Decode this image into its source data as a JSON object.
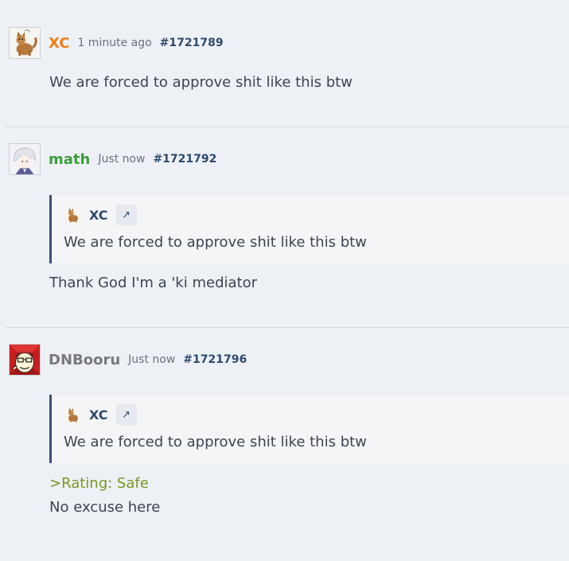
{
  "colors": {
    "background": "#edf1f6",
    "user_xc": "#ef7d1a",
    "user_math": "#3a9e3a",
    "user_dnbooru": "#7a7a7a",
    "post_id": "#2d4a6e",
    "greentext": "#789922",
    "quote_border": "#3c4f72"
  },
  "posts": [
    {
      "username": "XC",
      "timestamp": "1 minute ago",
      "post_id": "#1721789",
      "avatar_icon": "cat-avatar-icon",
      "body": "We are forced to approve shit like this btw"
    },
    {
      "username": "math",
      "timestamp": "Just now",
      "post_id": "#1721792",
      "avatar_icon": "anime-character-avatar-icon",
      "quote": {
        "username": "XC",
        "link_icon": "↗",
        "text": "We are forced to approve shit like this btw"
      },
      "body": "Thank God I'm a 'ki mediator"
    },
    {
      "username": "DNBooru",
      "timestamp": "Just now",
      "post_id": "#1721796",
      "avatar_icon": "cartoon-face-avatar-icon",
      "quote": {
        "username": "XC",
        "link_icon": "↗",
        "text": "We are forced to approve shit like this btw"
      },
      "greentext": ">Rating: Safe",
      "body": "No excuse here"
    }
  ]
}
